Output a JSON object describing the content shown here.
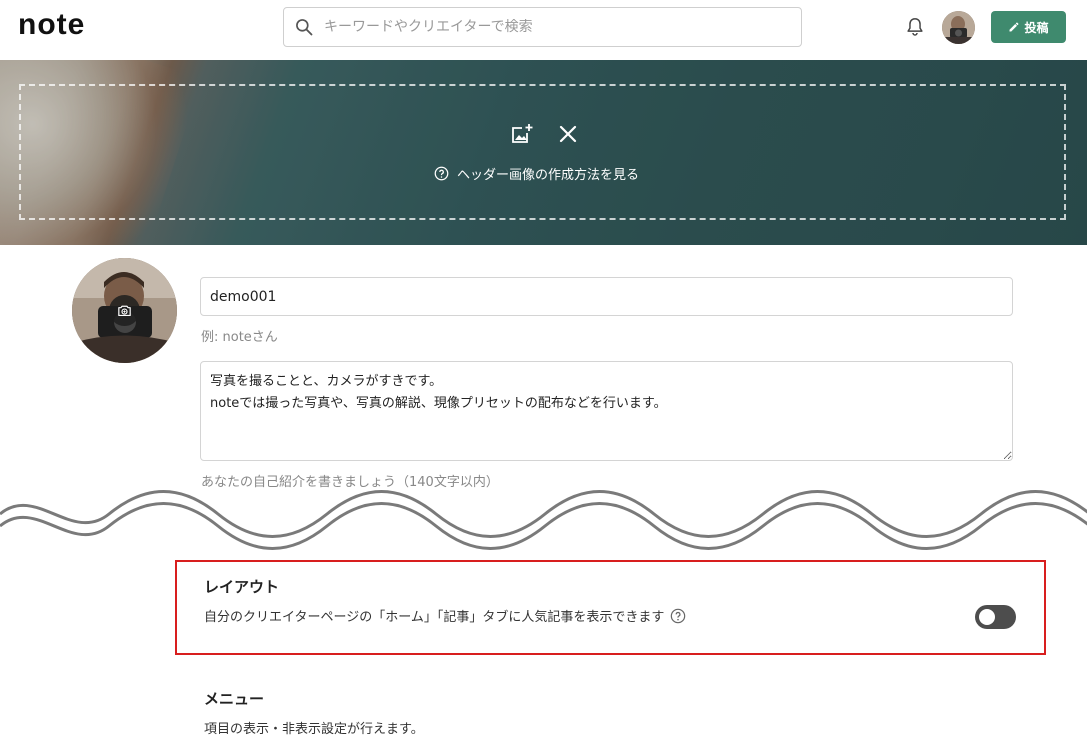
{
  "app": {
    "logo": "note"
  },
  "search": {
    "placeholder": "キーワードやクリエイターで検索"
  },
  "header_actions": {
    "post_label": "投稿"
  },
  "header_image": {
    "help_text": "ヘッダー画像の作成方法を見る"
  },
  "profile": {
    "name_value": "demo001",
    "name_hint": "例: noteさん",
    "bio_value": "写真を撮ることと、カメラがすきです。\nnoteでは撮った写真や、写真の解説、現像プリセットの配布などを行います。",
    "bio_hint": "あなたの自己紹介を書きましょう（140文字以内）"
  },
  "layout_section": {
    "title": "レイアウト",
    "description": "自分のクリエイターページの「ホーム」「記事」タブに人気記事を表示できます",
    "toggle_on": false,
    "highlight_color": "#d81e1e"
  },
  "menu_section": {
    "title": "メニュー",
    "description": "項目の表示・非表示設定が行えます。"
  },
  "colors": {
    "accent": "#3f8a6e",
    "toggle_off": "#4d4d4d"
  }
}
